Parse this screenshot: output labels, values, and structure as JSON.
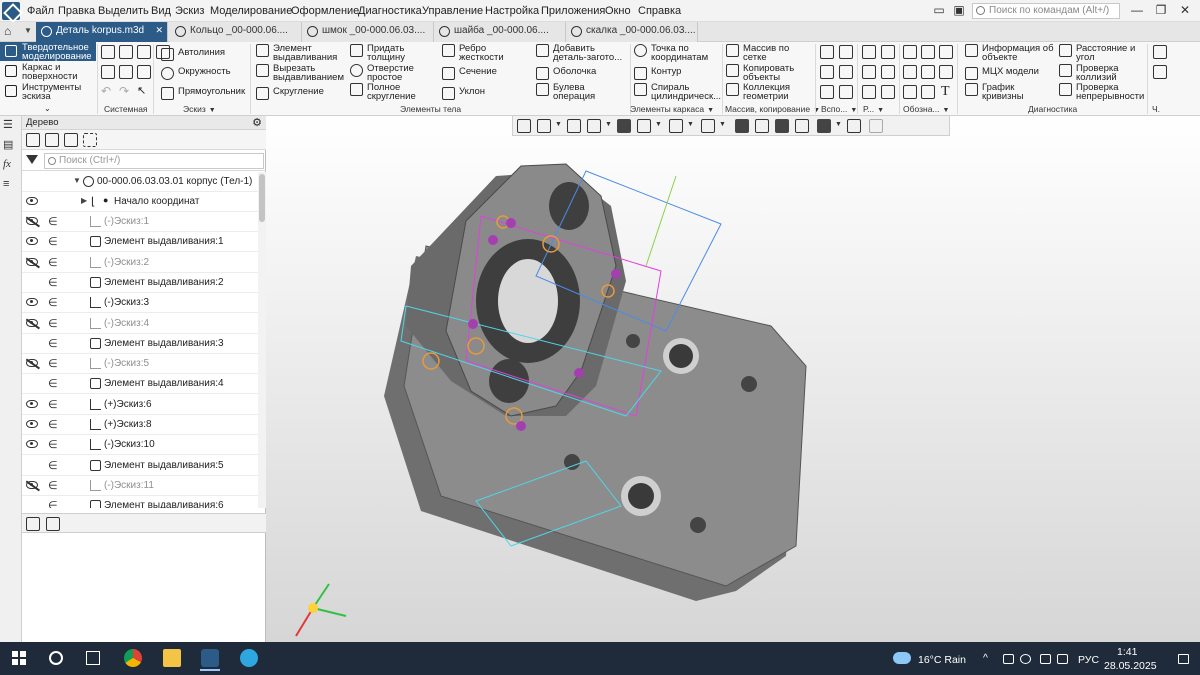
{
  "menu": {
    "items": [
      "Файл",
      "Правка",
      "Выделить",
      "Вид",
      "Эскиз",
      "Моделирование",
      "Оформление",
      "Диагностика",
      "Управление",
      "Настройка",
      "Приложения",
      "Окно",
      "Справка"
    ]
  },
  "search": {
    "placeholder": "Поиск по командам (Alt+/)"
  },
  "tabs": [
    {
      "label": "Деталь korpus.m3d",
      "active": true
    },
    {
      "label": "Кольцо _00-000.06...."
    },
    {
      "label": "шмок _00-000.06.03...."
    },
    {
      "label": "шайба _00-000.06...."
    },
    {
      "label": "скалка _00-000.06.03...."
    }
  ],
  "ribbon": {
    "left_items": [
      {
        "label": "Твердотельное моделирование",
        "active": true
      },
      {
        "label": "Каркас и поверхности"
      },
      {
        "label": "Инструменты эскиза"
      }
    ],
    "system_label": "Системная",
    "sketch_label": "Эскиз",
    "sketch_commands": [
      "Автолиния",
      "Окружность",
      "Прямоугольник"
    ],
    "body_label": "Элементы тела",
    "body_commands": [
      "Элемент выдавливания",
      "Вырезать выдавливанием",
      "Скругление",
      "Придать толщину",
      "Отверстие простое",
      "Полное скругление",
      "Ребро жесткости",
      "Сечение",
      "Уклон",
      "Добавить деталь-загото...",
      "Оболочка",
      "Булева операция"
    ],
    "frame_label": "Элементы каркаса",
    "frame_commands": [
      "Точка по координатам",
      "Контур",
      "Спираль цилиндрическ..."
    ],
    "array_label": "Массив, копирование",
    "array_commands": [
      "Массив по сетке",
      "Копировать объекты",
      "Коллекция геометрии"
    ],
    "aux_label": "Вспо...",
    "r_label": "Р...",
    "designation_label": "Обозна...",
    "diag_label": "Диагностика",
    "diag_commands": [
      "Информация об объекте",
      "МЦХ модели",
      "График кривизны",
      "Расстояние и угол",
      "Проверка коллизий",
      "Проверка непрерывности"
    ],
    "end_label": "Ч."
  },
  "tree": {
    "header": "Дерево",
    "filter_placeholder": "Поиск (Ctrl+/)",
    "root": "00-000.06.03.03.01 корпус (Тел-1)",
    "origin": "Начало координат",
    "rows": [
      {
        "label": "(-)Эскиз:1",
        "type": "sketch",
        "visible": "hidden"
      },
      {
        "label": "Элемент выдавливания:1",
        "type": "feature",
        "visible": "shown"
      },
      {
        "label": "(-)Эскиз:2",
        "type": "sketch",
        "visible": "hidden"
      },
      {
        "label": "Элемент выдавливания:2",
        "type": "feature",
        "visible": "none"
      },
      {
        "label": "(-)Эскиз:3",
        "type": "sketch",
        "visible": "shown"
      },
      {
        "label": "(-)Эскиз:4",
        "type": "sketch",
        "visible": "hidden"
      },
      {
        "label": "Элемент выдавливания:3",
        "type": "feature",
        "visible": "none"
      },
      {
        "label": "(-)Эскиз:5",
        "type": "sketch",
        "visible": "hidden"
      },
      {
        "label": "Элемент выдавливания:4",
        "type": "feature",
        "visible": "none"
      },
      {
        "label": "(+)Эскиз:6",
        "type": "sketch",
        "visible": "shown"
      },
      {
        "label": "(+)Эскиз:8",
        "type": "sketch",
        "visible": "shown"
      },
      {
        "label": "(-)Эскиз:10",
        "type": "sketch",
        "visible": "shown"
      },
      {
        "label": "Элемент выдавливания:5",
        "type": "feature",
        "visible": "none"
      },
      {
        "label": "(-)Эскиз:11",
        "type": "sketch",
        "visible": "hidden"
      },
      {
        "label": "Элемент выдавливания:6",
        "type": "feature",
        "visible": "none"
      }
    ]
  },
  "taskbar": {
    "weather": "16°C Rain",
    "lang": "РУС",
    "time": "1:41",
    "date": "28.05.2025"
  },
  "colors": {
    "accent": "#2d5b88",
    "sketch_orange": "#e89a3c",
    "sketch_magenta": "#e040e0",
    "sketch_cyan": "#4fd6e8",
    "sketch_blue": "#4a8be8",
    "axis_red": "#e03a3a",
    "axis_green": "#34c046",
    "model_gray": "#8a8a8a"
  }
}
